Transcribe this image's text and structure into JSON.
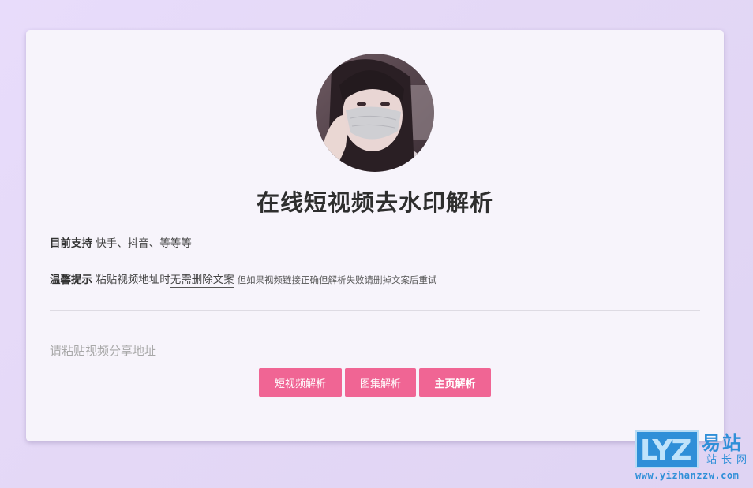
{
  "page": {
    "title": "在线短视频去水印解析"
  },
  "avatar": {
    "alt": "avatar",
    "icon": "profile-photo"
  },
  "support": {
    "label": "目前支持",
    "text": " 快手、抖音、等等等"
  },
  "tip": {
    "label": "温馨提示",
    "text_before": " 粘贴视频地址时",
    "underlined": "无需删除文案",
    "small": " 但如果视频链接正确但解析失败请删掉文案后重试"
  },
  "url_input": {
    "placeholder": "请粘贴视频分享地址",
    "value": ""
  },
  "buttons": {
    "video": "短视频解析",
    "gallery": "图集解析",
    "home": "主页解析"
  },
  "watermark": {
    "letters": "LYZ",
    "title": "易站",
    "subtitle": "站长网",
    "url": "www.yizhanzzw.com"
  },
  "colors": {
    "accent": "#f06594",
    "background": "#e6dbf8",
    "card": "#f7f4fb",
    "watermark": "#2f8fd8"
  }
}
